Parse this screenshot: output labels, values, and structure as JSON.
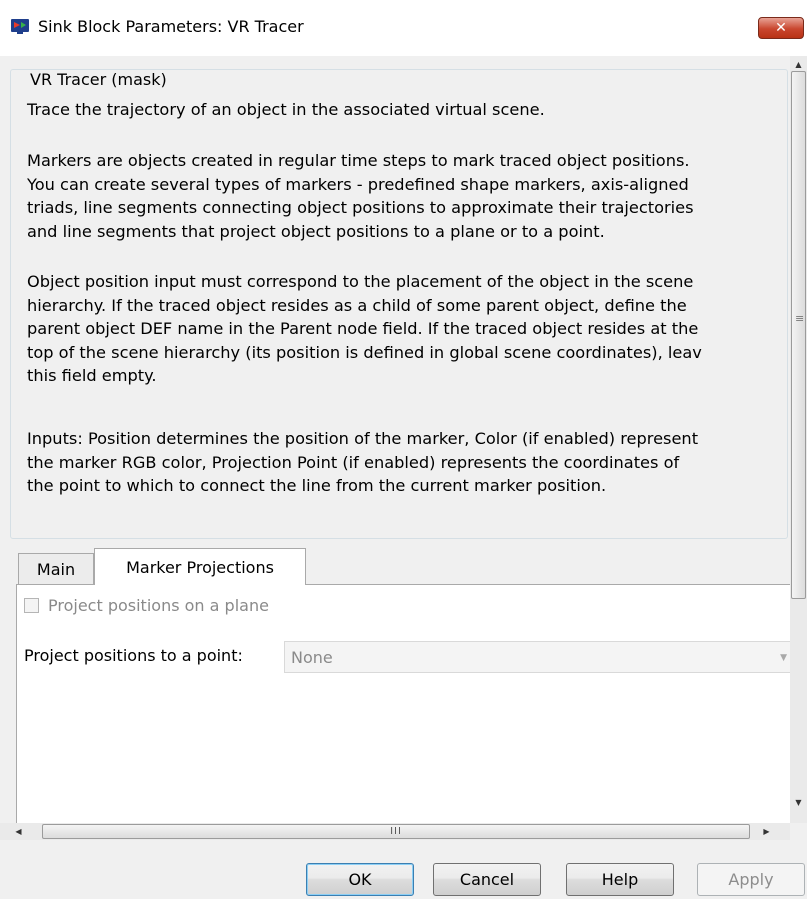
{
  "window": {
    "title": "Sink Block Parameters: VR Tracer",
    "close_glyph": "✕"
  },
  "mask": {
    "group_label": "VR Tracer (mask)",
    "paragraphs": [
      "Trace the trajectory of an object in the associated virtual scene.",
      "Markers are objects created in regular time steps to mark traced object positions.\nYou can create several types of markers - predefined shape markers, axis-aligned\ntriads, line segments connecting object positions to approximate their trajectories\nand line segments that project object positions to a plane or to a point.",
      "Object position input must correspond to the placement of the object in the scene\nhierarchy. If the traced object resides as a child of some parent object, define the\nparent object DEF name in the Parent node field. If the traced object resides at the\ntop of the scene hierarchy (its position is defined in global scene coordinates), leav\nthis field empty.",
      "Inputs: Position determines the position of the marker, Color (if enabled) represent\nthe marker RGB color, Projection Point (if enabled) represents the coordinates of\nthe point to which to connect the line from the current marker position."
    ]
  },
  "tabs": [
    {
      "label": "Main",
      "active": false
    },
    {
      "label": "Marker Projections",
      "active": true
    }
  ],
  "marker_projections": {
    "plane_checkbox_label": "Project positions on a plane",
    "plane_checked": false,
    "plane_enabled": false,
    "point_label": "Project positions to a point:",
    "point_value": "None"
  },
  "scrollbars": {
    "h_grip": "III"
  },
  "buttons": {
    "ok": "OK",
    "cancel": "Cancel",
    "help": "Help",
    "apply": "Apply"
  },
  "colors": {
    "close_button": "#c9462e",
    "default_button_border": "#3c7fb1",
    "disabled_text": "#8a8a8a"
  }
}
